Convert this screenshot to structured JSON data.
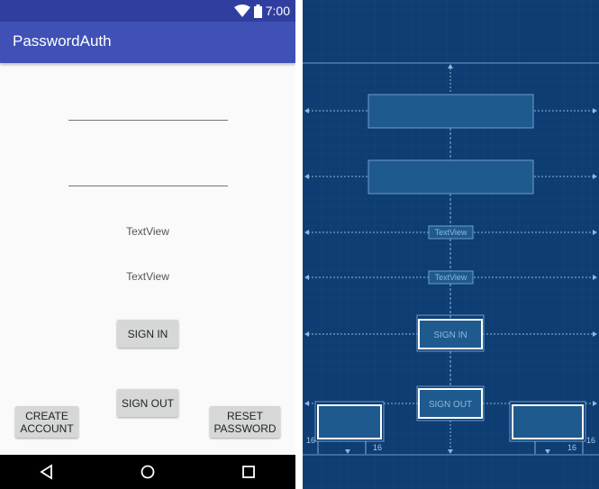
{
  "status_bar": {
    "time": "7:00"
  },
  "app_bar": {
    "title": "PasswordAuth"
  },
  "form": {
    "text_view_1": "TextView",
    "text_view_2": "TextView",
    "sign_in_label": "SIGN IN",
    "sign_out_label": "SIGN OUT",
    "create_account_label": "CREATE\nACCOUNT",
    "reset_password_label": "RESET\nPASSWORD"
  },
  "blueprint": {
    "text_view_1": "TextView",
    "text_view_2": "TextView",
    "sign_in_label": "SIGN IN",
    "sign_out_label": "SIGN OUT",
    "margins": [
      "16",
      "16",
      "16",
      "16"
    ]
  },
  "icons": {
    "status": [
      "wifi-icon",
      "battery-icon"
    ],
    "nav": [
      "back-icon",
      "home-icon",
      "recents-icon"
    ]
  },
  "colors": {
    "primary": "#3f51b5",
    "primary_dark": "#303f9f",
    "blueprint_bg": "#0e3d73"
  }
}
